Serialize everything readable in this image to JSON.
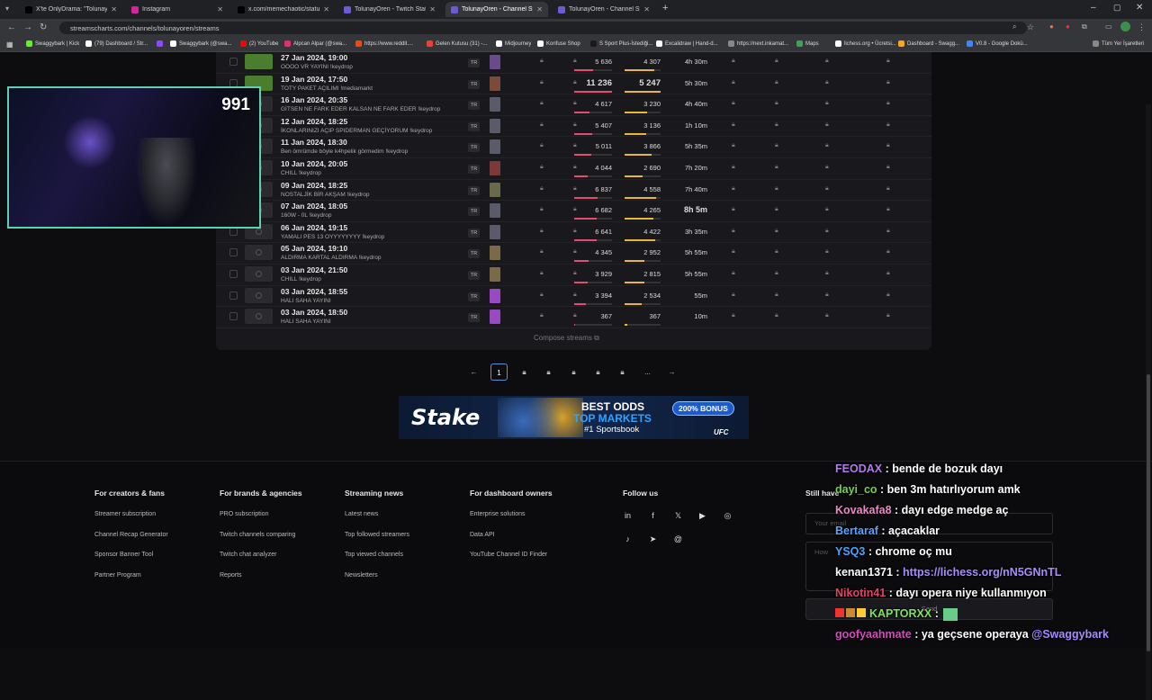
{
  "browser": {
    "tabs": [
      {
        "title": "X'te OnlyDrama: \"Tolunay Ören",
        "icon": "x-icon"
      },
      {
        "title": "Instagram",
        "icon": "instagram-icon"
      },
      {
        "title": "x.com/memechaotic/status/20",
        "icon": "x-icon"
      },
      {
        "title": "TolunayOren - Twitch Stats, An",
        "icon": "streamscharts-icon"
      },
      {
        "title": "TolunayOren - Channel Stream",
        "icon": "streamscharts-icon"
      },
      {
        "title": "TolunayOren - Channel Stream",
        "icon": "streamscharts-icon"
      }
    ],
    "new_tab": "+",
    "url": "streamscharts.com/channels/tolunayoren/streams",
    "bookmarks": [
      {
        "label": "Swaggybark | Kick",
        "color": "#53fc18"
      },
      {
        "label": "(79) Dashboard / Str...",
        "color": "#ffffff"
      },
      {
        "label": "",
        "color": "#9146ff"
      },
      {
        "label": "Swaggybark (@swa...",
        "color": "#ffffff"
      },
      {
        "label": "(2) YouTube",
        "color": "#ff0000"
      },
      {
        "label": "Alpcan Alpar (@swa...",
        "color": "#e1306c"
      },
      {
        "label": "https://www.reddit....",
        "color": "#ff4500"
      },
      {
        "label": "Gelen Kutusu (31) -...",
        "color": "#ea4335"
      },
      {
        "label": "Midjourney",
        "color": "#ffffff"
      },
      {
        "label": "Konfuse Shop",
        "color": "#ffffff"
      },
      {
        "label": "S Sport Plus-İstediği...",
        "color": "#1a1a1a"
      },
      {
        "label": "Excalidraw | Hand-d...",
        "color": "#ffffff"
      },
      {
        "label": "https://next.inkamat...",
        "color": "#888888"
      },
      {
        "label": "Maps",
        "color": "#34a853"
      },
      {
        "label": "lichess.org • Ücretsi...",
        "color": "#ffffff"
      },
      {
        "label": "Dashboard - Swagg...",
        "color": "#f5a623"
      },
      {
        "label": "V0.8 - Google Dokü...",
        "color": "#4285f4"
      }
    ],
    "all_bookmarks": "Tüm Yer İşaretleri"
  },
  "streams": [
    {
      "date": "27 Jan 2024, 19:00",
      "title": "OOOO VR YAYINI !keydrop",
      "lang": "TR",
      "peak": "5 636",
      "avg": "4 307",
      "duration": "4h 30m",
      "peak_frac": 0.5,
      "avg_frac": 0.82,
      "big": false
    },
    {
      "date": "19 Jan 2024, 17:50",
      "title": "TOTY PAKET AÇILIMI !mediamarkt",
      "lang": "TR",
      "peak": "11 236",
      "avg": "5 247",
      "duration": "5h 30m",
      "peak_frac": 1.0,
      "avg_frac": 1.0,
      "big": true
    },
    {
      "date": "16 Jan 2024, 20:35",
      "title": "GİTSEN NE FARK EDER KALSAN NE FARK EDER !keydrop",
      "lang": "TR",
      "peak": "4 617",
      "avg": "3 230",
      "duration": "4h 40m",
      "peak_frac": 0.41,
      "avg_frac": 0.62,
      "big": false
    },
    {
      "date": "12 Jan 2024, 18:25",
      "title": "İKONLARINIZI AÇIP SPIDERMAN GEÇİYORUM !keydrop",
      "lang": "TR",
      "peak": "5 407",
      "avg": "3 136",
      "duration": "1h 10m",
      "peak_frac": 0.48,
      "avg_frac": 0.6,
      "big": false
    },
    {
      "date": "11 Jan 2024, 18:30",
      "title": "Ben ömrümde böyle k4hpelik görmedim !keydrop",
      "lang": "TR",
      "peak": "5 011",
      "avg": "3 866",
      "duration": "5h 35m",
      "peak_frac": 0.45,
      "avg_frac": 0.74,
      "big": false
    },
    {
      "date": "10 Jan 2024, 20:05",
      "title": "CHILL !keydrop",
      "lang": "TR",
      "peak": "4 044",
      "avg": "2 690",
      "duration": "7h 20m",
      "peak_frac": 0.36,
      "avg_frac": 0.51,
      "big": false
    },
    {
      "date": "09 Jan 2024, 18:25",
      "title": "NOSTALJİK BİR AKŞAM !keydrop",
      "lang": "TR",
      "peak": "6 837",
      "avg": "4 558",
      "duration": "7h 40m",
      "peak_frac": 0.61,
      "avg_frac": 0.87,
      "big": false
    },
    {
      "date": "07 Jan 2024, 18:05",
      "title": "160W - 0L !keydrop",
      "lang": "TR",
      "peak": "6 682",
      "avg": "4 265",
      "duration": "8h 5m",
      "peak_frac": 0.59,
      "avg_frac": 0.81,
      "big": false
    },
    {
      "date": "06 Jan 2024, 19:15",
      "title": "YAMALI PES 13 OYYYYYYYY !keydrop",
      "lang": "TR",
      "peak": "6 641",
      "avg": "4 422",
      "duration": "3h 35m",
      "peak_frac": 0.59,
      "avg_frac": 0.84,
      "big": false
    },
    {
      "date": "05 Jan 2024, 19:10",
      "title": "ALDIRMA KARTAL ALDIRMA !keydrop",
      "lang": "TR",
      "peak": "4 345",
      "avg": "2 952",
      "duration": "5h 55m",
      "peak_frac": 0.39,
      "avg_frac": 0.56,
      "big": false
    },
    {
      "date": "03 Jan 2024, 21:50",
      "title": "CHILL !keydrop",
      "lang": "TR",
      "peak": "3 929",
      "avg": "2 815",
      "duration": "5h 55m",
      "peak_frac": 0.35,
      "avg_frac": 0.54,
      "big": false
    },
    {
      "date": "03 Jan 2024, 18:55",
      "title": "HALI SAHA YAYINI",
      "lang": "TR",
      "peak": "3 394",
      "avg": "2 534",
      "duration": "55m",
      "peak_frac": 0.3,
      "avg_frac": 0.48,
      "big": false
    },
    {
      "date": "03 Jan 2024, 18:50",
      "title": "HALI SAHA YAYINI",
      "lang": "TR",
      "peak": "367",
      "avg": "367",
      "duration": "10m",
      "peak_frac": 0.03,
      "avg_frac": 0.07,
      "big": false
    }
  ],
  "compose": "Compose streams",
  "pagination": {
    "prev": "←",
    "current": "1",
    "ellipsis": "...",
    "next": "→"
  },
  "ad": {
    "brand": "Stake",
    "line1": "BEST ODDS",
    "line2": "TOP MARKETS",
    "line3": "#1 Sportsbook",
    "bonus": "200% BONUS",
    "partner": "UFC"
  },
  "footer": {
    "cols": [
      {
        "heading": "For creators & fans",
        "links": [
          "Streamer subscription",
          "Channel Recap Generator",
          "Sponsor Banner Tool",
          "Partner Program"
        ]
      },
      {
        "heading": "For brands & agencies",
        "links": [
          "PRO subscription",
          "Twitch channels comparing",
          "Twitch chat analyzer",
          "Reports"
        ]
      },
      {
        "heading": "Streaming news",
        "links": [
          "Latest news",
          "Top followed streamers",
          "Top viewed channels",
          "Newsletters"
        ]
      },
      {
        "heading": "For dashboard owners",
        "links": [
          "Enterprise solutions",
          "Data API",
          "YouTube Channel ID Finder"
        ]
      }
    ],
    "follow": "Follow us",
    "question": "Still have",
    "email_placeholder": "Your email",
    "message_placeholder": "How",
    "send": "Send"
  },
  "webcam": {
    "viewers": "991"
  },
  "chat": [
    {
      "user": "FEODAX",
      "msg": " : bende de bozuk dayı",
      "color": "#b37bea",
      "badges": "",
      "link": ""
    },
    {
      "user": "dayi_co",
      "msg": " : ben 3m hatırlıyorum amk",
      "color": "#6fd44a",
      "badges": "",
      "link": ""
    },
    {
      "user": "Kovakafa8",
      "msg": " : dayı edge medge aç",
      "color": "#e98ac6",
      "badges": "",
      "link": ""
    },
    {
      "user": "Bertaraf",
      "msg": " : açacaklar",
      "color": "#5aa4ff",
      "badges": "",
      "link": ""
    },
    {
      "user": "YSQ3",
      "msg": " : chrome oç mu",
      "color": "#4aa3ff",
      "badges": "",
      "link": ""
    },
    {
      "user": "kenan1371",
      "msg": " : ",
      "color": "#ffffff",
      "badges": "",
      "link": "https://lichess.org/nN5GNnTL"
    },
    {
      "user": "Nikotin41",
      "msg": " : dayı opera niye kullanmıyon",
      "color": "#e0446a",
      "badges": "",
      "link": ""
    },
    {
      "user": "KAPTORXX",
      "msg": " : ",
      "color": "#7ee35c",
      "badges": "",
      "link": ""
    },
    {
      "user": "goofyaahmate",
      "msg": " : ya geçsene operaya ",
      "color": "#d44cc0",
      "badges": "",
      "link": "@Swaggybark"
    }
  ]
}
